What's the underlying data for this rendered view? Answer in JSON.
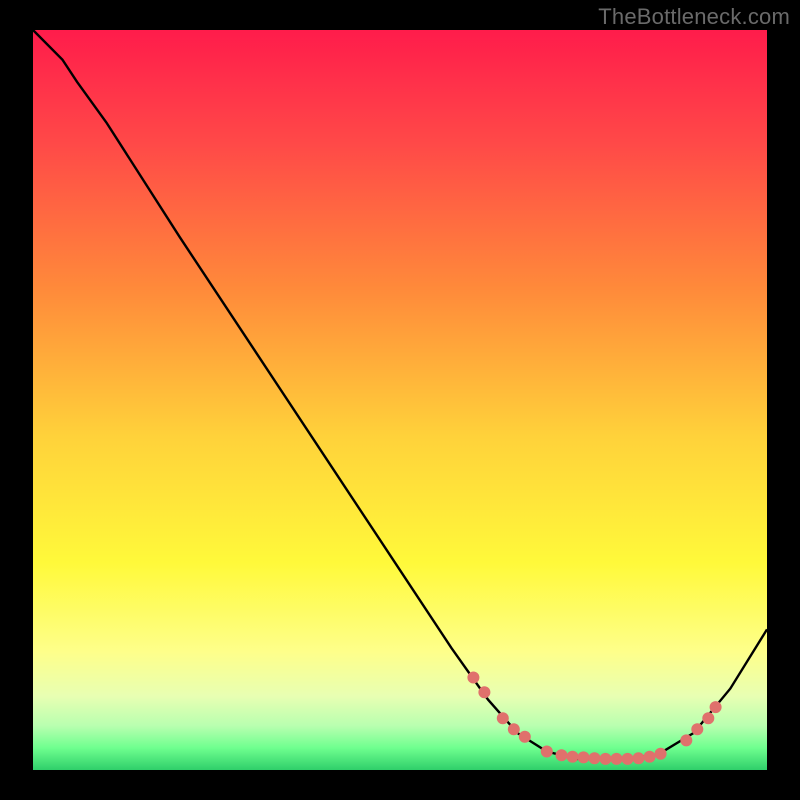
{
  "watermark": "TheBottleneck.com",
  "colors": {
    "frame_bg": "#000000",
    "curve_stroke": "#000000",
    "point_fill": "#e0716c",
    "green_band": "#2fcf6a"
  },
  "chart_data": {
    "type": "line",
    "title": "",
    "xlabel": "",
    "ylabel": "",
    "xlim": [
      0,
      100
    ],
    "ylim": [
      0,
      100
    ],
    "gradient_stops": [
      {
        "offset": 0.0,
        "color": "#ff1c4b"
      },
      {
        "offset": 0.15,
        "color": "#ff4848"
      },
      {
        "offset": 0.35,
        "color": "#ff8a3a"
      },
      {
        "offset": 0.55,
        "color": "#ffd23a"
      },
      {
        "offset": 0.72,
        "color": "#fff93a"
      },
      {
        "offset": 0.84,
        "color": "#feff8a"
      },
      {
        "offset": 0.9,
        "color": "#e8ffb2"
      },
      {
        "offset": 0.94,
        "color": "#b9ffb0"
      },
      {
        "offset": 0.97,
        "color": "#6fff8f"
      },
      {
        "offset": 1.0,
        "color": "#2fcf6a"
      }
    ],
    "curve": [
      {
        "x": 0.0,
        "y": 100.0
      },
      {
        "x": 4.0,
        "y": 96.0
      },
      {
        "x": 6.0,
        "y": 93.0
      },
      {
        "x": 10.0,
        "y": 87.5
      },
      {
        "x": 20.0,
        "y": 72.0
      },
      {
        "x": 30.0,
        "y": 57.0
      },
      {
        "x": 40.0,
        "y": 42.0
      },
      {
        "x": 50.0,
        "y": 27.0
      },
      {
        "x": 57.0,
        "y": 16.5
      },
      {
        "x": 62.0,
        "y": 9.5
      },
      {
        "x": 66.0,
        "y": 5.0
      },
      {
        "x": 70.0,
        "y": 2.5
      },
      {
        "x": 74.0,
        "y": 1.5
      },
      {
        "x": 80.0,
        "y": 1.5
      },
      {
        "x": 85.0,
        "y": 2.0
      },
      {
        "x": 90.0,
        "y": 5.0
      },
      {
        "x": 95.0,
        "y": 11.0
      },
      {
        "x": 100.0,
        "y": 19.0
      }
    ],
    "points": [
      {
        "x": 60.0,
        "y": 12.5
      },
      {
        "x": 61.5,
        "y": 10.5
      },
      {
        "x": 64.0,
        "y": 7.0
      },
      {
        "x": 65.5,
        "y": 5.5
      },
      {
        "x": 67.0,
        "y": 4.5
      },
      {
        "x": 70.0,
        "y": 2.5
      },
      {
        "x": 72.0,
        "y": 2.0
      },
      {
        "x": 73.5,
        "y": 1.8
      },
      {
        "x": 75.0,
        "y": 1.7
      },
      {
        "x": 76.5,
        "y": 1.6
      },
      {
        "x": 78.0,
        "y": 1.5
      },
      {
        "x": 79.5,
        "y": 1.5
      },
      {
        "x": 81.0,
        "y": 1.5
      },
      {
        "x": 82.5,
        "y": 1.6
      },
      {
        "x": 84.0,
        "y": 1.8
      },
      {
        "x": 85.5,
        "y": 2.2
      },
      {
        "x": 89.0,
        "y": 4.0
      },
      {
        "x": 90.5,
        "y": 5.5
      },
      {
        "x": 92.0,
        "y": 7.0
      },
      {
        "x": 93.0,
        "y": 8.5
      }
    ]
  }
}
